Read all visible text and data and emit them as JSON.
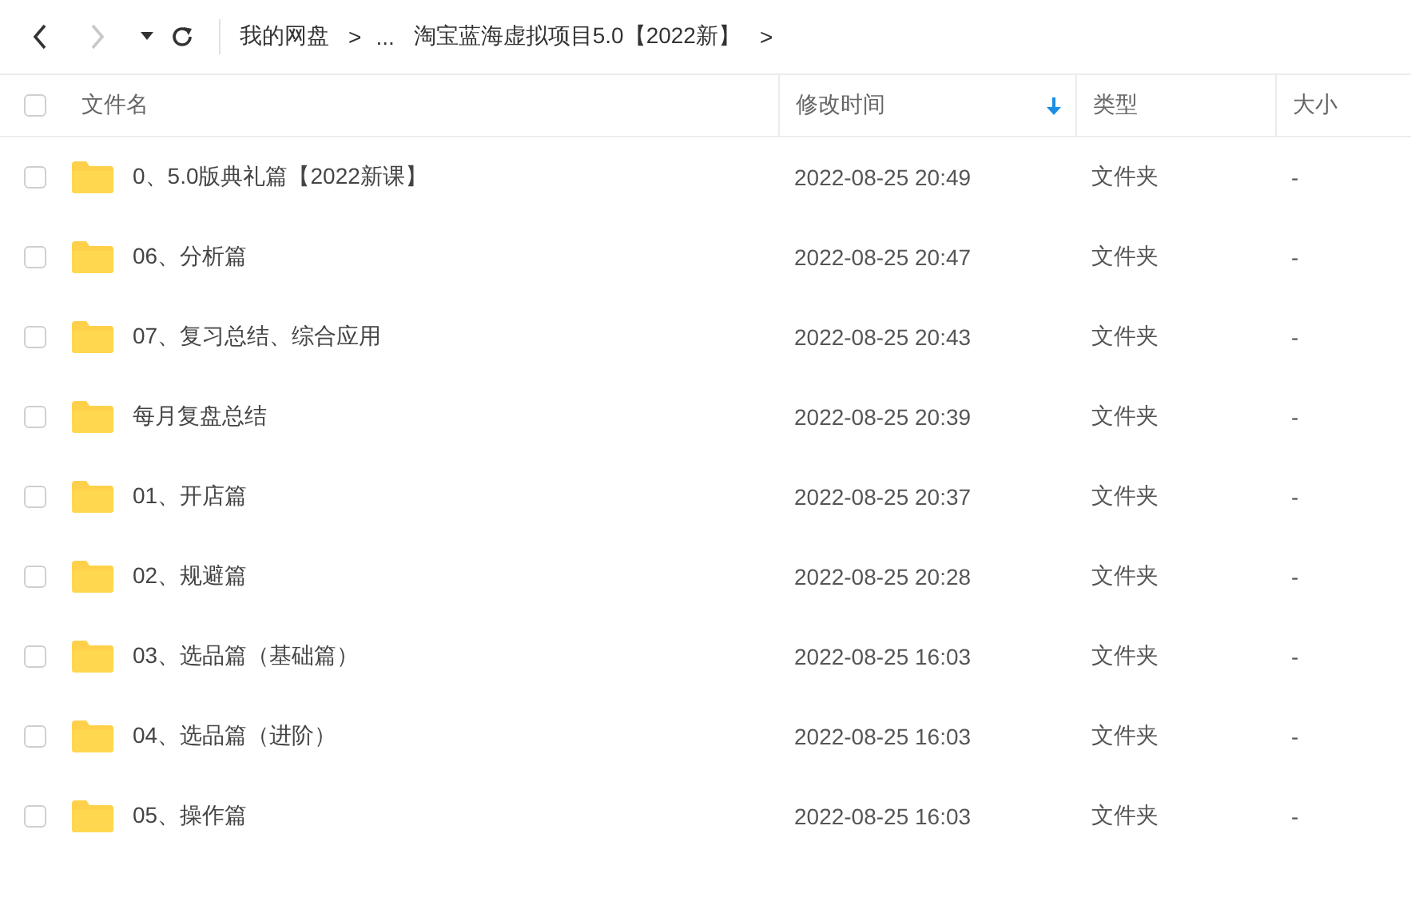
{
  "toolbar": {
    "back": {
      "disabled": false
    },
    "forward": {
      "disabled": true
    },
    "breadcrumb": [
      {
        "kind": "crumb",
        "text": "我的网盘"
      },
      {
        "kind": "separator",
        "text": ">"
      },
      {
        "kind": "ellipsis",
        "text": "..."
      },
      {
        "kind": "crumb",
        "text": "淘宝蓝海虚拟项目5.0【2022新】"
      },
      {
        "kind": "separator",
        "text": ">"
      }
    ]
  },
  "table": {
    "select_all": {
      "checked": false
    },
    "columns": [
      {
        "label": "文件名",
        "sorted": false
      },
      {
        "label": "修改时间",
        "sorted": true
      },
      {
        "label": "类型",
        "sorted": false
      },
      {
        "label": "大小",
        "sorted": false
      }
    ],
    "rows": [
      {
        "checked": false,
        "name": "0、5.0版典礼篇【2022新课】",
        "modified": "2022-08-25 20:49",
        "type": "文件夹",
        "size": "-"
      },
      {
        "checked": false,
        "name": "06、分析篇",
        "modified": "2022-08-25 20:47",
        "type": "文件夹",
        "size": "-"
      },
      {
        "checked": false,
        "name": "07、复习总结、综合应用",
        "modified": "2022-08-25 20:43",
        "type": "文件夹",
        "size": "-"
      },
      {
        "checked": false,
        "name": "每月复盘总结",
        "modified": "2022-08-25 20:39",
        "type": "文件夹",
        "size": "-"
      },
      {
        "checked": false,
        "name": "01、开店篇",
        "modified": "2022-08-25 20:37",
        "type": "文件夹",
        "size": "-"
      },
      {
        "checked": false,
        "name": "02、规避篇",
        "modified": "2022-08-25 20:28",
        "type": "文件夹",
        "size": "-"
      },
      {
        "checked": false,
        "name": "03、选品篇（基础篇）",
        "modified": "2022-08-25 16:03",
        "type": "文件夹",
        "size": "-"
      },
      {
        "checked": false,
        "name": "04、选品篇（进阶）",
        "modified": "2022-08-25 16:03",
        "type": "文件夹",
        "size": "-"
      },
      {
        "checked": false,
        "name": "05、操作篇",
        "modified": "2022-08-25 16:03",
        "type": "文件夹",
        "size": "-"
      }
    ]
  }
}
